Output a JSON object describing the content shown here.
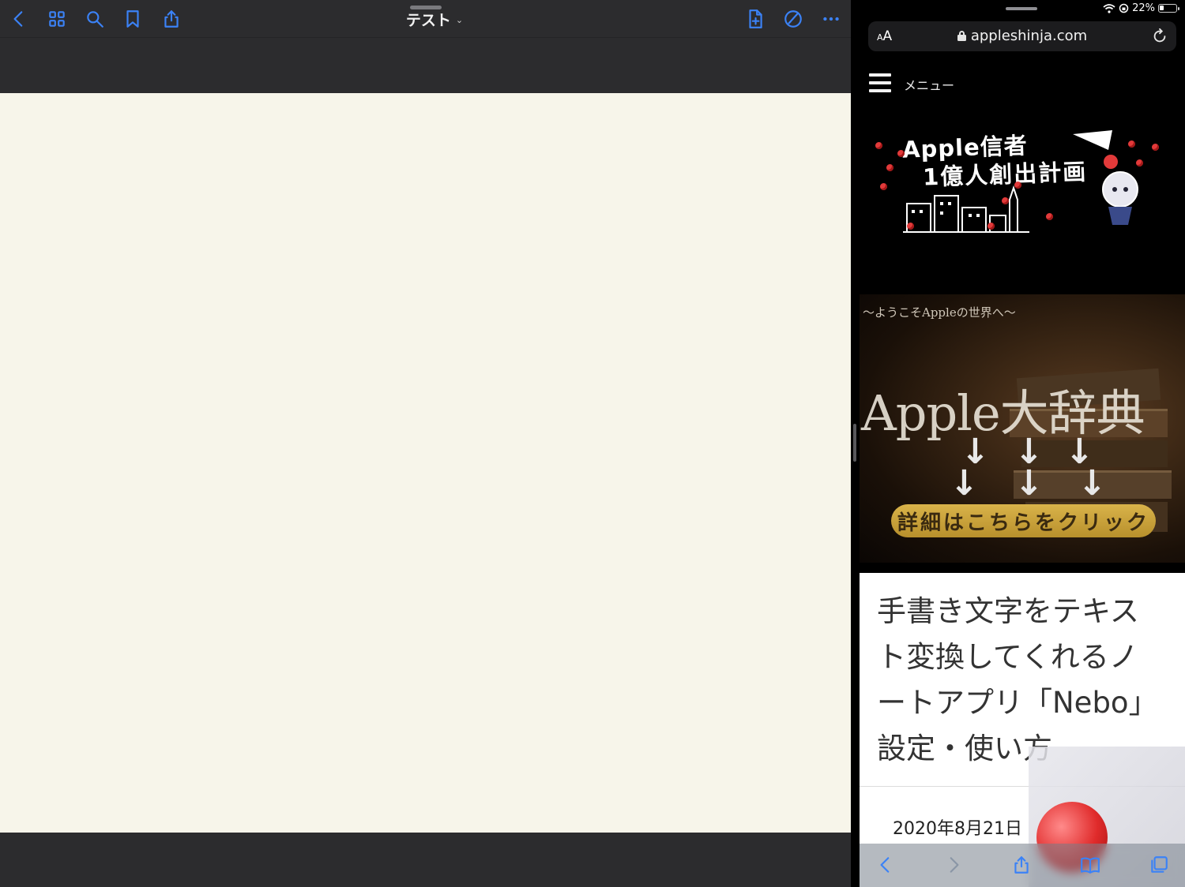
{
  "left_app": {
    "document_title": "テスト",
    "toolbar_icons": [
      "back-chevron-icon",
      "grid-icon",
      "search-icon",
      "bookmark-icon",
      "share-icon",
      "add-page-icon",
      "pen-icon",
      "more-icon"
    ],
    "accent_color": "#3b82f6",
    "page_color": "#f7f5ea"
  },
  "status_bar": {
    "battery": "22%",
    "icons": [
      "wifi-icon",
      "orientation-lock-icon",
      "battery-icon"
    ]
  },
  "safari": {
    "text_size_label": "AA",
    "url": "appleshinja.com",
    "menu_label": "メニュー",
    "hero": {
      "line1": "Apple信者",
      "line2": "1億人創出計画"
    },
    "banner": {
      "subtitle": "〜ようこそAppleの世界へ〜",
      "title": "Apple大辞典",
      "cta": "詳細はこちらをクリック"
    },
    "article": {
      "title": "手書き文字をテキスト変換してくれるノートアプリ「Nebo」設定・使い方",
      "date": "2020年8月21日"
    },
    "toolbar_icons": [
      "back-icon",
      "forward-icon",
      "share-icon",
      "bookmarks-icon",
      "tabs-icon"
    ]
  }
}
